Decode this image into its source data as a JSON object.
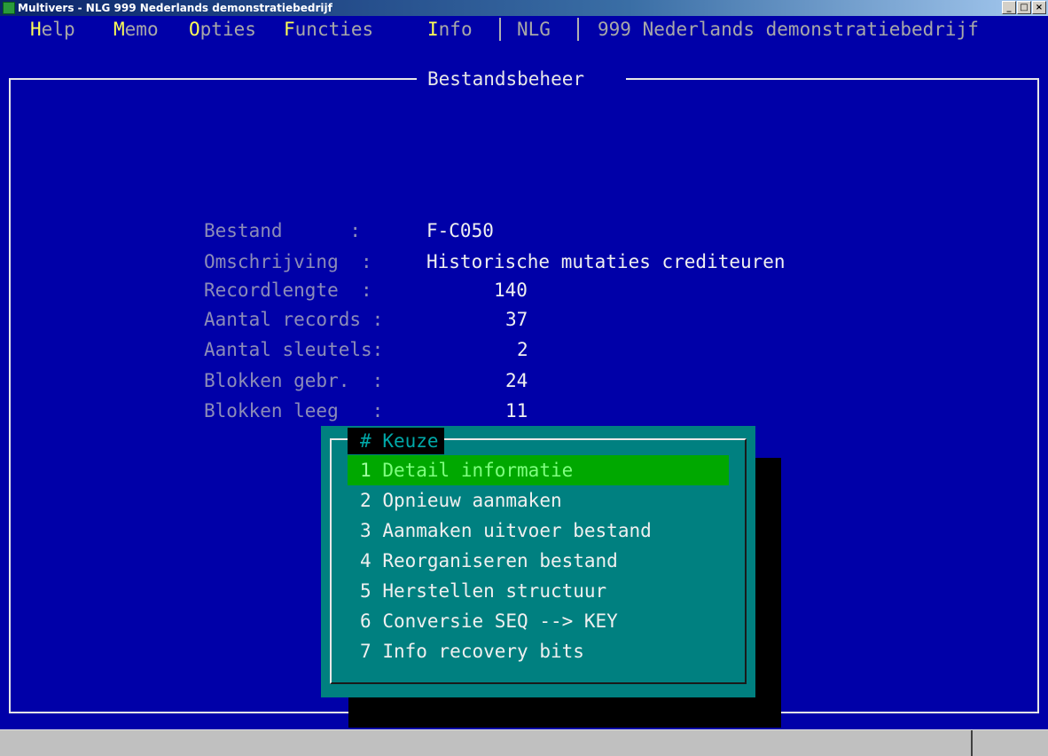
{
  "window": {
    "title": "Multivers - NLG  999 Nederlands demonstratiebedrijf",
    "min_label": "_",
    "max_label": "□",
    "close_label": "×"
  },
  "menu": {
    "items": [
      {
        "hot": "H",
        "rest": "elp"
      },
      {
        "hot": "M",
        "rest": "emo"
      },
      {
        "hot": "O",
        "rest": "pties"
      },
      {
        "hot": "F",
        "rest": "uncties"
      },
      {
        "hot": "I",
        "rest": "nfo"
      }
    ],
    "currency": "NLG",
    "company": "999 Nederlands demonstratiebedrijf"
  },
  "screen": {
    "title": "Bestandsbeheer"
  },
  "fileinfo": [
    {
      "label": "Bestand      :",
      "value": "F-C050"
    },
    {
      "label": "Omschrijving  :",
      "value": "Historische mutaties crediteuren"
    },
    {
      "label": "Recordlengte  :",
      "value": "140"
    },
    {
      "label": "Aantal records :",
      "value": "37"
    },
    {
      "label": "Aantal sleutels:",
      "value": "2"
    },
    {
      "label": "Blokken gebr.  :",
      "value": "24"
    },
    {
      "label": "Blokken leeg   :",
      "value": "11"
    }
  ],
  "dialog": {
    "title_hash": "#",
    "title": "Keuze",
    "selected_index": 0,
    "options": [
      {
        "num": "1",
        "label": "Detail informatie"
      },
      {
        "num": "2",
        "label": "Opnieuw aanmaken"
      },
      {
        "num": "3",
        "label": "Aanmaken uitvoer bestand"
      },
      {
        "num": "4",
        "label": "Reorganiseren bestand"
      },
      {
        "num": "5",
        "label": "Herstellen structuur"
      },
      {
        "num": "6",
        "label": "Conversie SEQ --> KEY"
      },
      {
        "num": "7",
        "label": "Info recovery bits"
      }
    ]
  },
  "colors": {
    "background": "#0000a8",
    "dialog": "#008080",
    "selection": "#00a800",
    "hotkey": "#ffff55"
  }
}
